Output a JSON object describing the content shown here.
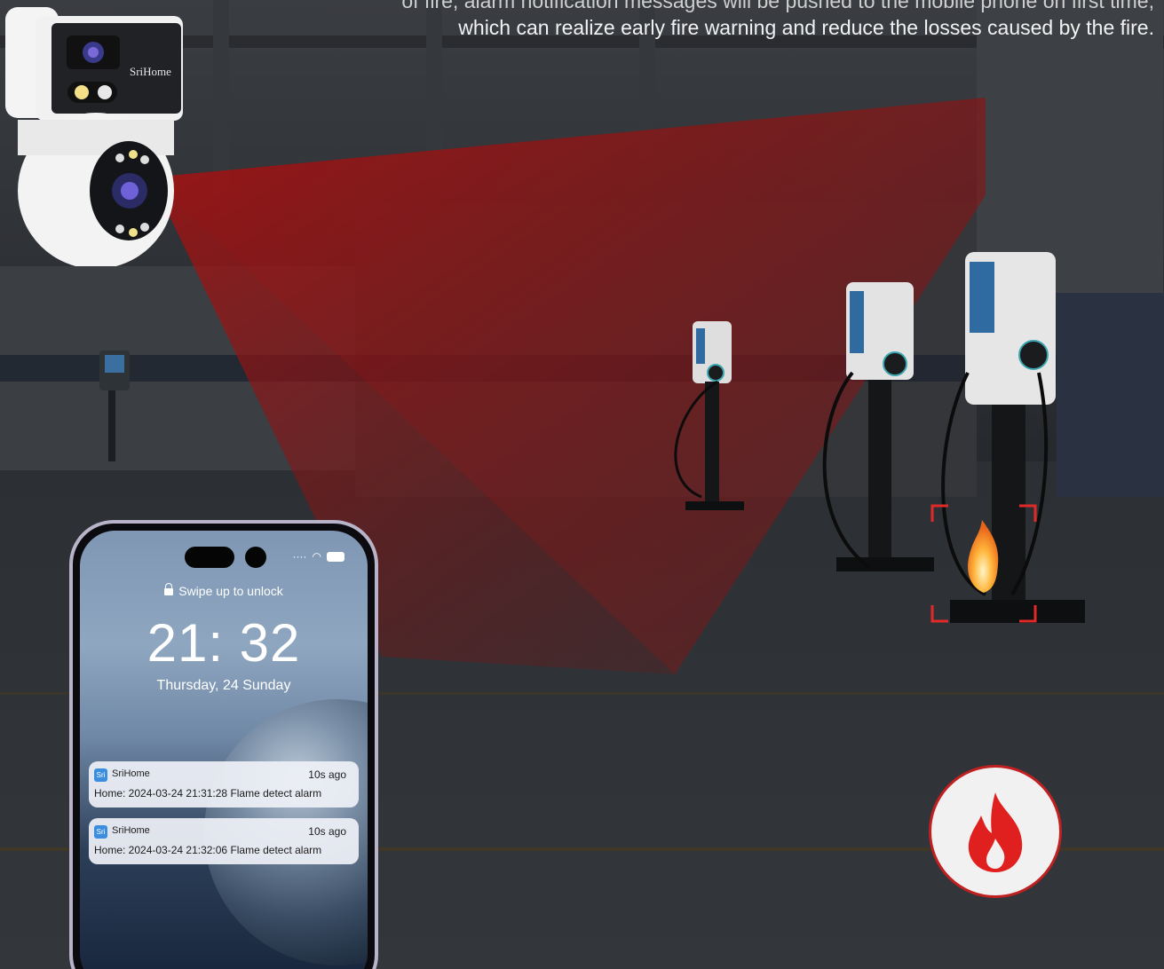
{
  "caption": {
    "line1": "of fire, alarm notification messages will be pushed to the mobile phone on first time,",
    "line2": "which can realize early fire warning and reduce the losses caused by the fire."
  },
  "camera": {
    "brand": "SriHome"
  },
  "phone": {
    "unlock_text": "Swipe up to unlock",
    "time": "21: 32",
    "date": "Thursday, 24 Sunday",
    "notifications": [
      {
        "app_icon_text": "Sri",
        "app_name": "SriHome",
        "ago": "10s ago",
        "message": "Home: 2024-03-24  21:31:28 Flame detect alarm"
      },
      {
        "app_icon_text": "Sri",
        "app_name": "SriHome",
        "ago": "10s ago",
        "message": "Home: 2024-03-24  21:32:06 Flame detect alarm"
      }
    ]
  },
  "icons": {
    "fire_badge": "fire-icon",
    "lock": "lock-icon"
  },
  "colors": {
    "alert_red": "#d41f1f",
    "detection_frame": "#e02a2a",
    "background": "#2a2d31"
  }
}
